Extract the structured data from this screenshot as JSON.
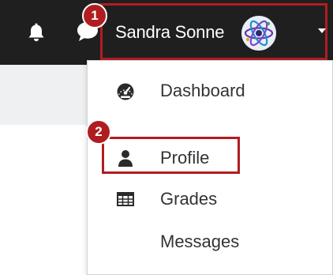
{
  "header": {
    "notifications_icon": "bell-icon",
    "messages_icon": "chat-bubble-icon",
    "user": {
      "name": "Sandra Sonne",
      "avatar_icon": "atom-avatar-icon",
      "caret_icon": "caret-down-icon"
    }
  },
  "user_menu": {
    "items": [
      {
        "label": "Dashboard",
        "icon": "dashboard-gauge-icon"
      },
      {
        "label": "Profile",
        "icon": "user-icon"
      },
      {
        "label": "Grades",
        "icon": "table-grid-icon"
      },
      {
        "label": "Messages",
        "icon": ""
      }
    ]
  },
  "callouts": {
    "step_1": "1",
    "step_2": "2"
  },
  "colors": {
    "topbar": "#1f1f1f",
    "highlight": "#b01d20",
    "page_strip": "#eef0f2",
    "menu_text": "#333333"
  }
}
